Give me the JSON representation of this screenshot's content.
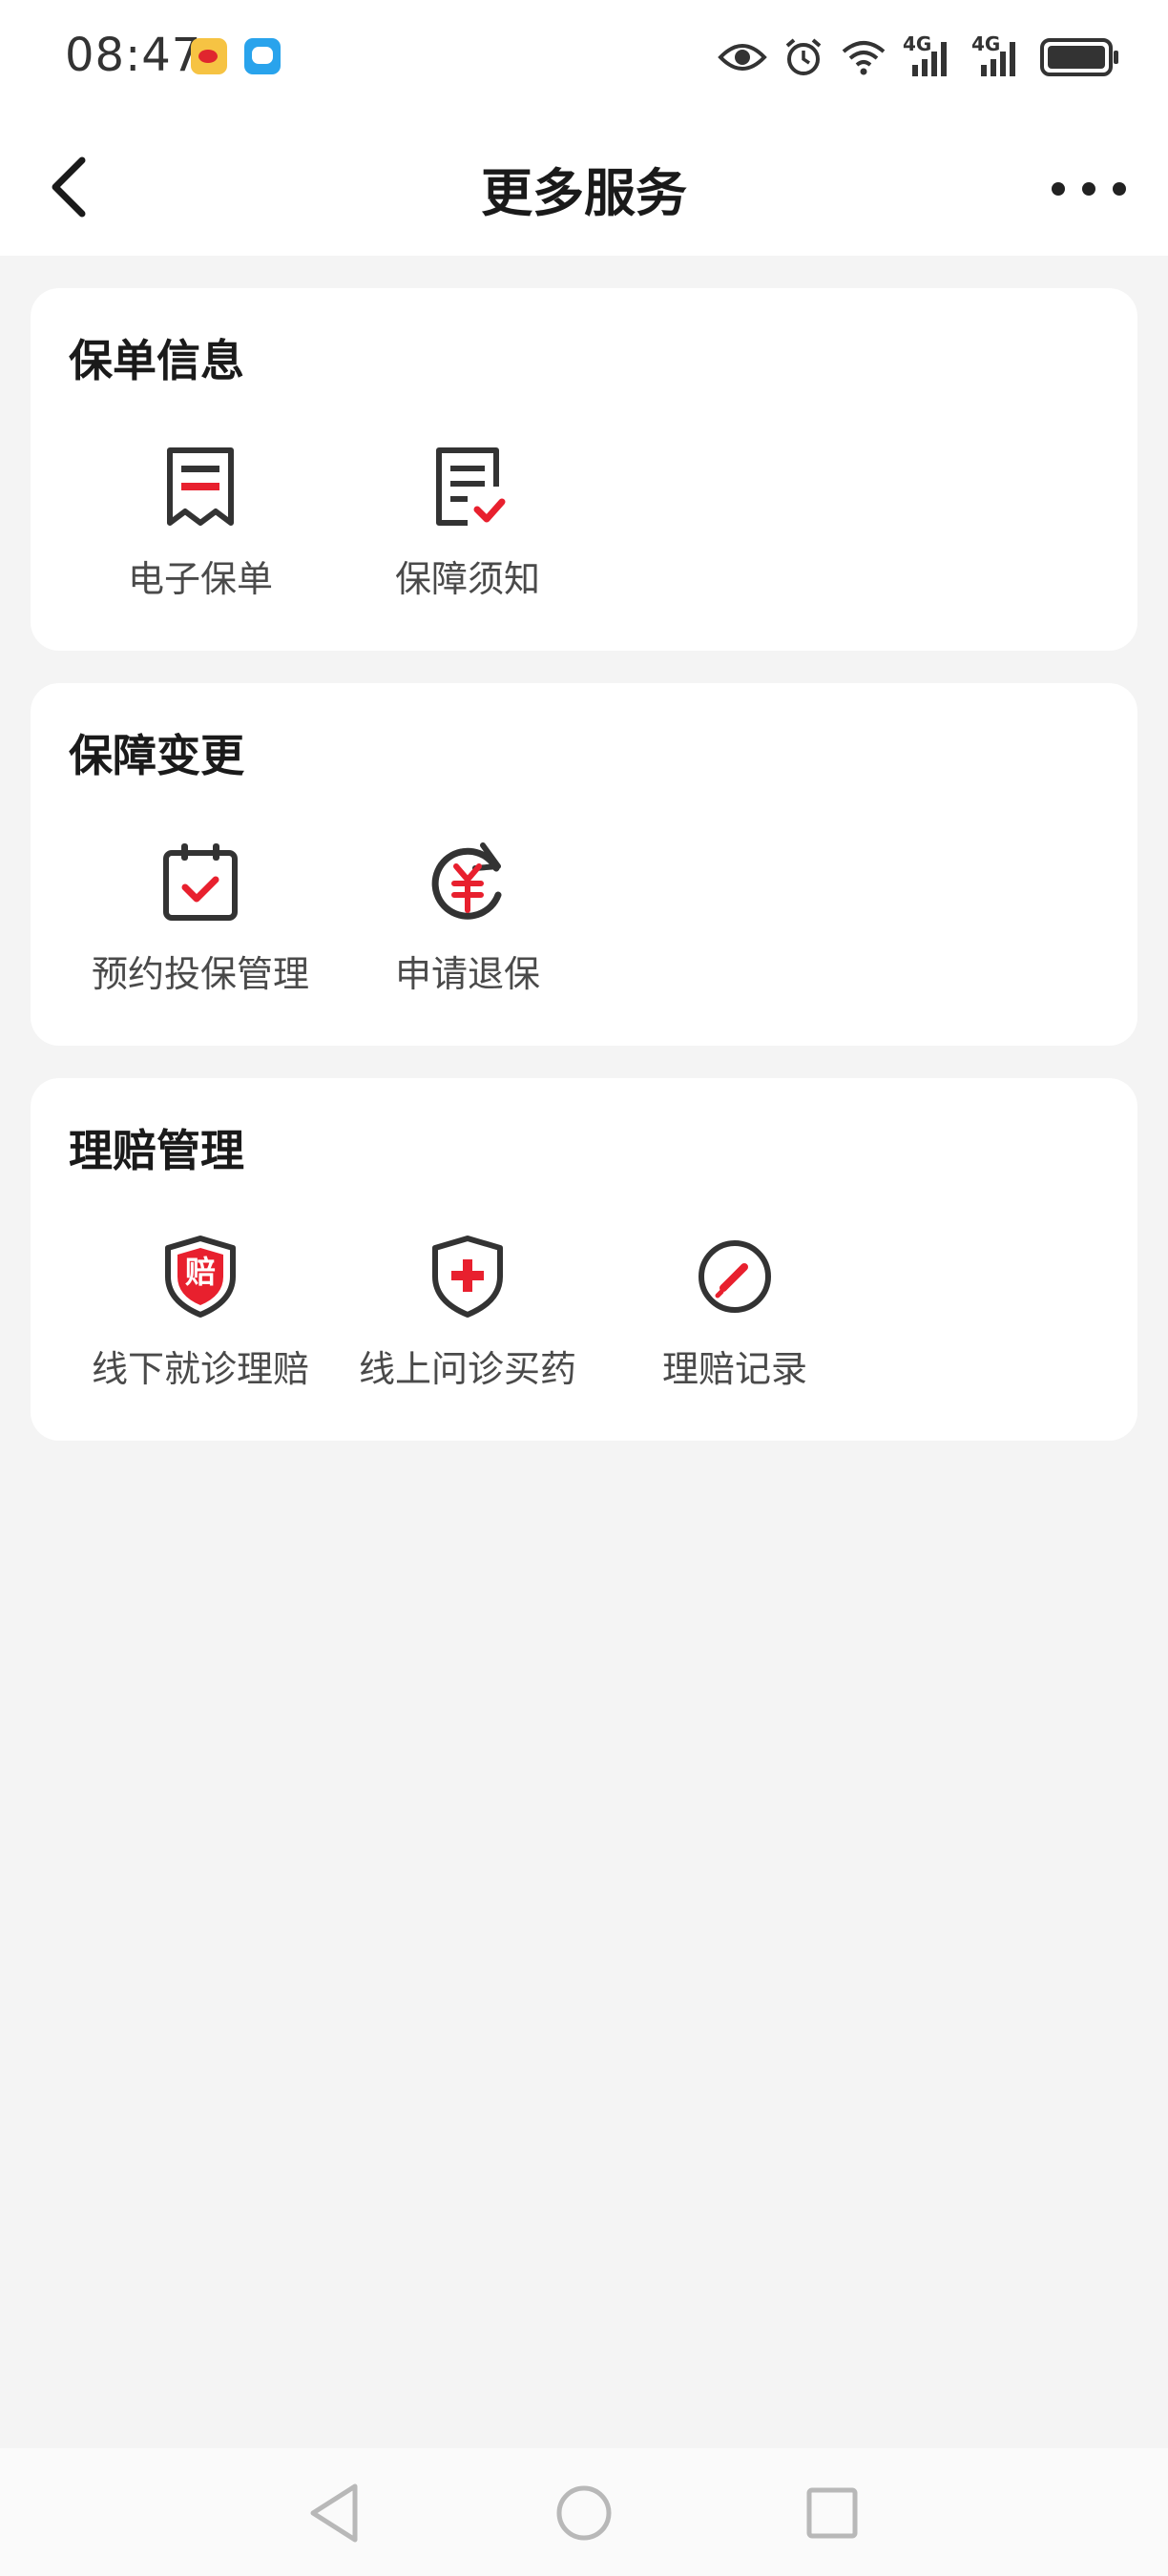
{
  "status_bar": {
    "time": "08:47",
    "icons": [
      "weibo-notification-icon",
      "message-notification-icon",
      "eye-icon",
      "alarm-icon",
      "wifi-icon",
      "signal-4g-icon",
      "signal-4g-icon",
      "battery-icon"
    ],
    "signal_label_1": "4G",
    "signal_label_2": "4G"
  },
  "header": {
    "title": "更多服务",
    "back_icon": "chevron-left-icon",
    "more_icon": "more-dots-icon"
  },
  "sections": [
    {
      "title": "保单信息",
      "items": [
        {
          "label": "电子保单",
          "icon": "document-icon"
        },
        {
          "label": "保障须知",
          "icon": "document-check-icon"
        }
      ]
    },
    {
      "title": "保障变更",
      "items": [
        {
          "label": "预约投保管理",
          "icon": "calendar-check-icon"
        },
        {
          "label": "申请退保",
          "icon": "refund-yuan-icon"
        }
      ]
    },
    {
      "title": "理赔管理",
      "items": [
        {
          "label": "线下就诊理赔",
          "icon": "claim-shield-icon",
          "icon_text": "赔"
        },
        {
          "label": "线上问诊买药",
          "icon": "medical-shield-icon"
        },
        {
          "label": "理赔记录",
          "icon": "record-edit-icon"
        }
      ]
    }
  ],
  "nav_bar": {
    "items": [
      "back-triangle-icon",
      "home-circle-icon",
      "recents-square-icon"
    ]
  },
  "colors": {
    "accent": "#e8202e",
    "icon_dark": "#333333",
    "background": "#f4f4f4",
    "card": "#ffffff"
  }
}
